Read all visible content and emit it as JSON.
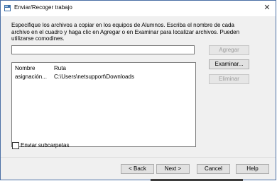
{
  "window": {
    "title": "Enviar/Recoger trabajo",
    "instructions": "Especifique los archivos a copiar en los equipos de Alumnos. Escriba el nombre de cada archivo en el cuadro y haga clic en Agregar o en Examinar para localizar archivos. Pueden utilizarse comodines."
  },
  "file_input": {
    "value": "",
    "placeholder": ""
  },
  "side_buttons": {
    "add_label": "Agregar",
    "browse_label": "Examinar...",
    "remove_label": "Eliminar"
  },
  "list": {
    "columns": [
      "Nombre",
      "Ruta"
    ],
    "rows": [
      {
        "name": "asignación...",
        "path": "C:\\Users\\netsupport\\Downloads"
      }
    ]
  },
  "options": {
    "send_subfolders_label": "Enviar subcarpetas",
    "send_subfolders_checked": false
  },
  "footer": {
    "back_label": "< Back",
    "next_label": "Next >",
    "cancel_label": "Cancel",
    "help_label": "Help"
  },
  "colors": {
    "disabled_text": "#9d9d9d",
    "button_face": "#e1e1e1",
    "dialog_bg": "#f0f0f0",
    "title_icon": "#3c6ea6"
  }
}
